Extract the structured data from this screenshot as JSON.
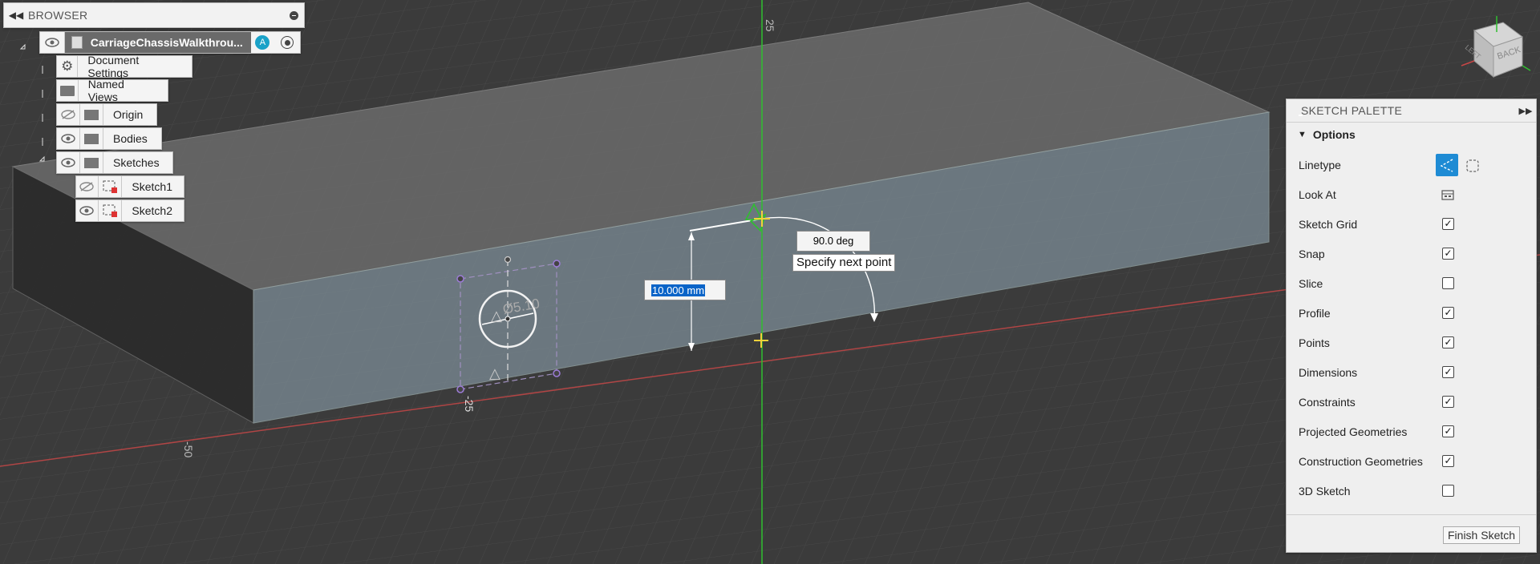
{
  "browser": {
    "title": "BROWSER",
    "root_name": "CarriageChassisWalkthrou...",
    "items": [
      {
        "label": "Document Settings"
      },
      {
        "label": "Named Views"
      },
      {
        "label": "Origin"
      },
      {
        "label": "Bodies"
      },
      {
        "label": "Sketches"
      },
      {
        "label": "Sketch1"
      },
      {
        "label": "Sketch2"
      }
    ]
  },
  "viewport": {
    "axis_label_top": "25",
    "axis_label_left": "-50",
    "axis_label_sketch": "-25",
    "diameter_dim": "Ø5.10",
    "angle_input": "90.0 deg",
    "length_input": "10.000 mm",
    "tooltip": "Specify next point"
  },
  "viewcube": {
    "face": "BACK",
    "side": "LEFT"
  },
  "palette": {
    "title": "SKETCH PALETTE",
    "section": "Options",
    "rows": [
      {
        "label": "Linetype",
        "checked": null
      },
      {
        "label": "Look At",
        "checked": null
      },
      {
        "label": "Sketch Grid",
        "checked": true
      },
      {
        "label": "Snap",
        "checked": true
      },
      {
        "label": "Slice",
        "checked": false
      },
      {
        "label": "Profile",
        "checked": true
      },
      {
        "label": "Points",
        "checked": true
      },
      {
        "label": "Dimensions",
        "checked": true
      },
      {
        "label": "Constraints",
        "checked": true
      },
      {
        "label": "Projected Geometries",
        "checked": true
      },
      {
        "label": "Construction Geometries",
        "checked": true
      },
      {
        "label": "3D Sketch",
        "checked": false
      }
    ],
    "finish_label": "Finish Sketch"
  },
  "colors": {
    "accent": "#1e8bd4",
    "y_axis": "#27c427",
    "x_axis": "#c84646",
    "selection": "#0a64c8"
  }
}
